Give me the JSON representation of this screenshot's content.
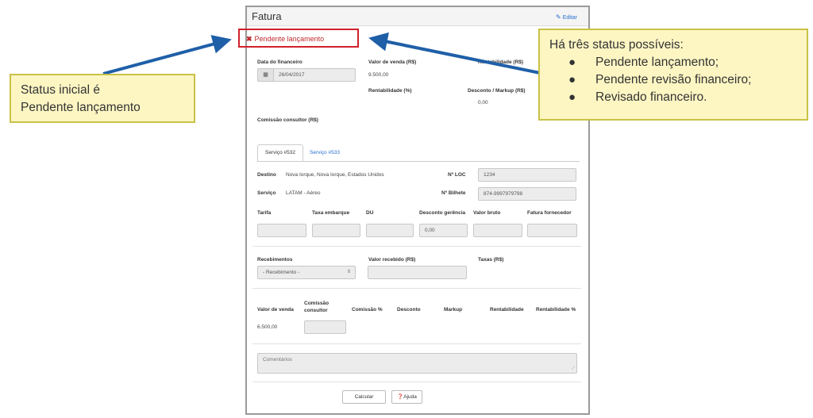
{
  "panel": {
    "title": "Fatura",
    "edit_label": "Editar"
  },
  "status": {
    "label": "Pendente lançamento",
    "color": "#c0272d"
  },
  "financeiro": {
    "data_label": "Data do financeiro",
    "data_value": "26/04/2017",
    "valor_venda_label": "Valor de venda (R$)",
    "valor_venda_value": "9.500,00",
    "rentabilidade_label": "Rentabilidade (R$)",
    "rentabilidade_pct_label": "Rentabilidade (%)",
    "desconto_label": "Desconto / Markup (R$)",
    "desconto_value": "0,00",
    "comissao_label": "Comissão consultor (R$)"
  },
  "tabs": [
    {
      "label": "Serviço #532",
      "active": true
    },
    {
      "label": "Serviço #533",
      "active": false
    }
  ],
  "servico": {
    "destino_label": "Destino",
    "destino_value": "Nova Iorque, Nova Iorque, Estados Unidos",
    "servico_label": "Serviço",
    "servico_value": "LATAM - Aéreo",
    "loc_label": "Nº LOC",
    "loc_value": "1234",
    "bilhete_label": "Nº Bilhete",
    "bilhete_value": "874-9997979798"
  },
  "tarifas": {
    "columns": [
      "Tarifa",
      "Taxa embarque",
      "DU",
      "Desconto gerência",
      "Valor bruto",
      "Fatura fornecedor"
    ],
    "values": [
      "",
      "",
      "",
      "0,00",
      "",
      ""
    ]
  },
  "recebimentos": {
    "label": "Recebimentos",
    "select_value": "- Recebimento -",
    "valor_recebido_label": "Valor recebido (R$)",
    "taxas_label": "Taxas (R$)"
  },
  "resumo": {
    "columns": [
      "Valor de venda",
      "Comissão consultor",
      "Comissão %",
      "Desconto",
      "Markup",
      "Rentabilidade",
      "Rentabilidade %"
    ],
    "valor_venda": "6.500,00"
  },
  "comentarios_placeholder": "Comentários",
  "buttons": {
    "calcular": "Calcular",
    "ajuda": "Ajuda"
  },
  "callout_left": {
    "line1": "Status inicial é",
    "line2": "Pendente lançamento"
  },
  "callout_right": {
    "title": "Há três status possíveis:",
    "items": [
      "Pendente lançamento;",
      "Pendente revisão financeiro;",
      "Revisado financeiro."
    ]
  },
  "colors": {
    "arrow": "#1f5fa8",
    "callout_bg": "#fdf6c3",
    "callout_border": "#c9c246",
    "status_border": "#d0202a",
    "link": "#2a6fcf"
  }
}
